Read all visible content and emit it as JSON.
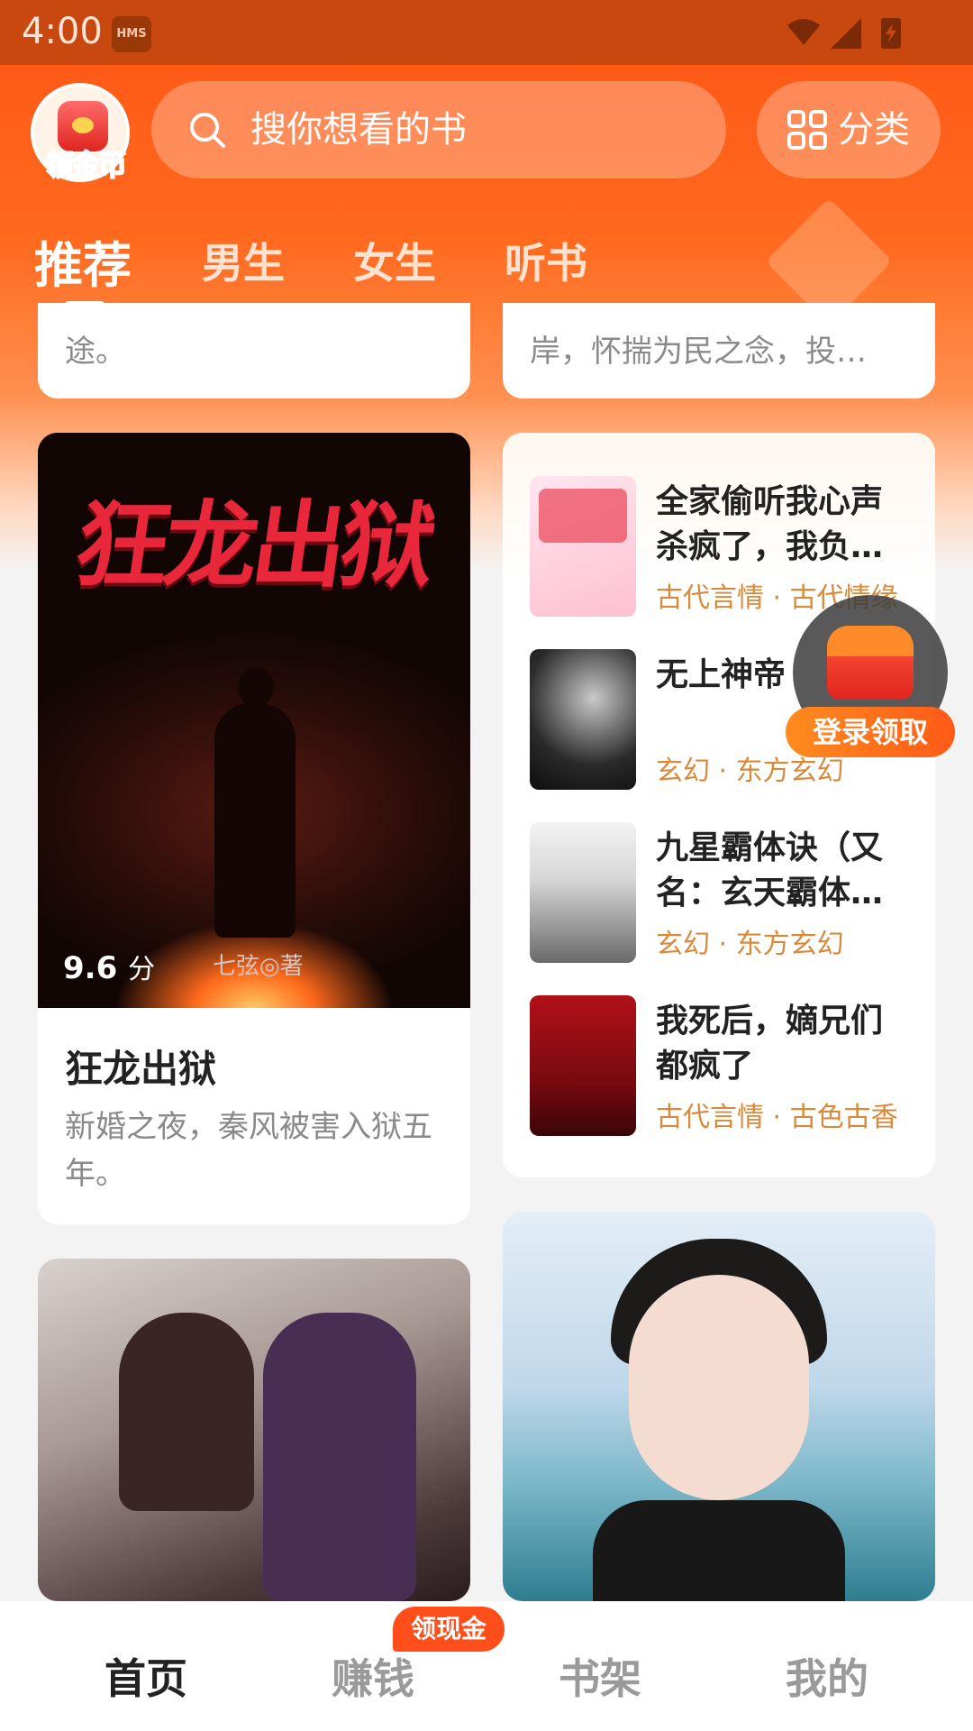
{
  "status_bar": {
    "time": "4:00",
    "hms_label": "HMS"
  },
  "header": {
    "coin_badge_label": "领金币",
    "search_placeholder": "搜你想看的书",
    "category_label": "分类"
  },
  "tabs": [
    {
      "label": "推荐",
      "active": true
    },
    {
      "label": "男生",
      "active": false
    },
    {
      "label": "女生",
      "active": false
    },
    {
      "label": "听书",
      "active": false
    }
  ],
  "top_cards": {
    "left_text": "途。",
    "right_text": "岸，怀揣为民之念，投…"
  },
  "featured_book": {
    "cover_title": "狂龙出狱",
    "score": "9.6",
    "score_unit": "分",
    "cover_author": "七弦◎著",
    "title": "狂龙出狱",
    "description": "新婚之夜，秦风被害入狱五年。"
  },
  "book_list": [
    {
      "title": "全家偷听我心声杀疯了，我负…",
      "tag": "古代言情 · 古代情缘"
    },
    {
      "title": "无上神帝",
      "tag": "玄幻 · 东方玄幻"
    },
    {
      "title": "九星霸体诀（又名：玄天霸体…",
      "tag": "玄幻 · 东方玄幻"
    },
    {
      "title": "我死后，嫡兄们都疯了",
      "tag": "古代言情 · 古色古香"
    }
  ],
  "floating_badge": {
    "label": "登录领取"
  },
  "bottom_nav": {
    "items": [
      {
        "label": "首页",
        "active": true
      },
      {
        "label": "赚钱",
        "active": false
      },
      {
        "label": "书架",
        "active": false
      },
      {
        "label": "我的",
        "active": false
      }
    ],
    "cash_badge": "领现金"
  },
  "colors": {
    "brand_orange": "#ff5a17",
    "tag_color": "#d9893a",
    "badge_red": "#ff4e1a"
  }
}
